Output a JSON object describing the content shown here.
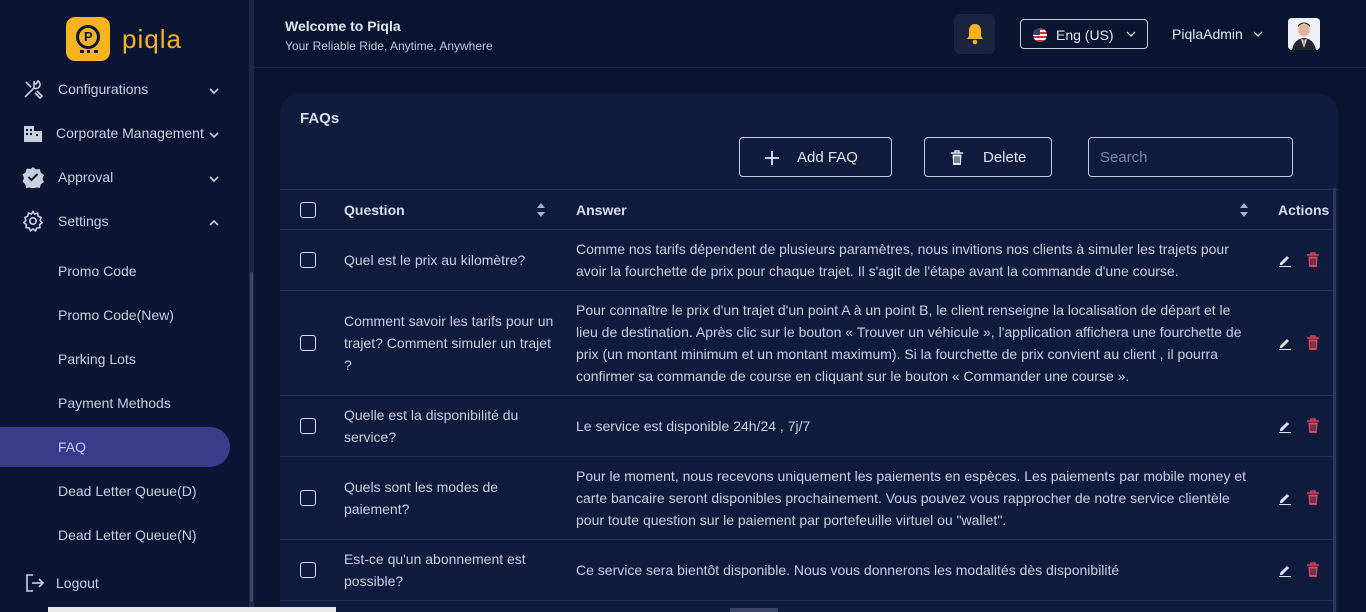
{
  "app": {
    "brand": "piqla",
    "welcome": "Welcome to Piqla",
    "tagline": "Your Reliable Ride, Anytime, Anywhere"
  },
  "sidebar": {
    "main_items": [
      {
        "label": "Configurations",
        "icon": "tools-icon",
        "expanded": false
      },
      {
        "label": "Corporate Management",
        "icon": "building-icon",
        "expanded": false
      },
      {
        "label": "Approval",
        "icon": "badge-check-icon",
        "expanded": false
      },
      {
        "label": "Settings",
        "icon": "gear-icon",
        "expanded": true
      }
    ],
    "sub_items": [
      {
        "label": "Promo Code",
        "active": false
      },
      {
        "label": "Promo Code(New)",
        "active": false
      },
      {
        "label": "Parking Lots",
        "active": false
      },
      {
        "label": "Payment Methods",
        "active": false
      },
      {
        "label": "FAQ",
        "active": true
      },
      {
        "label": "Dead Letter Queue(D)",
        "active": false
      },
      {
        "label": "Dead Letter Queue(N)",
        "active": false
      }
    ],
    "logout": {
      "label": "Logout",
      "icon": "logout-icon"
    }
  },
  "header": {
    "language": "Eng (US)",
    "username": "PiqlaAdmin"
  },
  "faq": {
    "title": "FAQs",
    "add_label": "Add FAQ",
    "delete_label": "Delete",
    "search_placeholder": "Search",
    "columns": {
      "question": "Question",
      "answer": "Answer",
      "actions": "Actions"
    },
    "rows": [
      {
        "question": "Quel est le prix au kilomètre?",
        "answer": "Comme nos tarifs dépendent de plusieurs paramètres, nous invitions nos clients à simuler les trajets pour avoir la fourchette de prix pour chaque trajet. Il s'agit de l'étape avant la commande d'une course."
      },
      {
        "question": "Comment savoir les tarifs pour un trajet? Comment simuler un trajet ?",
        "answer": "Pour connaître le prix d'un trajet d'un point A à un point B, le client renseigne la localisation de départ et le lieu de destination. Après clic sur le bouton « Trouver un véhicule », l'application affichera une fourchette de prix (un montant minimum et un montant maximum). Si la fourchette de prix convient au client , il pourra confirmer sa commande de course en cliquant sur le bouton « Commander une course »."
      },
      {
        "question": "Quelle est la disponibilité du service?",
        "answer": "Le service est disponible 24h/24 , 7j/7"
      },
      {
        "question": "Quels sont les modes de paiement?",
        "answer": "Pour le moment, nous recevons uniquement les paiements en espèces. Les paiements par mobile money et carte bancaire seront disponibles prochainement. Vous pouvez vous rapprocher de notre service clientèle pour toute question sur le paiement par portefeuille virtuel ou \"wallet\"."
      },
      {
        "question": "Est-ce qu'un abonnement est possible?",
        "answer": "Ce service sera bientôt disponible. Nous vous donnerons les modalités dès disponibilité"
      }
    ]
  },
  "colors": {
    "accent": "#f6b41f",
    "active_nav": "#3a3b8b",
    "delete": "#e0455a",
    "background": "#0b1430",
    "card": "#101c3e"
  }
}
